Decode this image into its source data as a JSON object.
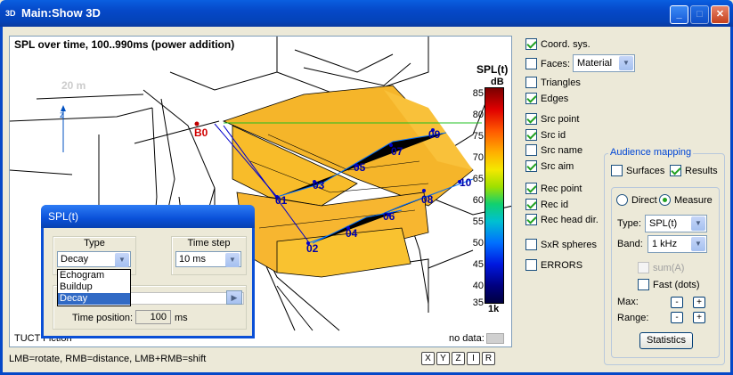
{
  "window": {
    "title": "Main:Show 3D",
    "icon": "3D"
  },
  "view": {
    "title": "SPL over time, 100..990ms (power addition)",
    "distance_label": "20 m",
    "axis_z": "z",
    "source_label": "B0",
    "receivers": [
      "01",
      "02",
      "03",
      "04",
      "05",
      "06",
      "07",
      "08",
      "09",
      "10"
    ],
    "status_left": "TUCT Fiction",
    "no_data_label": "no data:",
    "colorbar": {
      "title": "SPL(t)",
      "unit": "dB",
      "ticks": [
        "85",
        "80",
        "75",
        "70",
        "65",
        "60",
        "55",
        "50",
        "45",
        "40",
        "35"
      ],
      "footer": "1k"
    }
  },
  "statusbar": {
    "hint": "LMB=rotate, RMB=distance, LMB+RMB=shift",
    "axis_buttons": [
      "X",
      "Y",
      "Z",
      "I",
      "R"
    ]
  },
  "options": {
    "coord_sys": {
      "label": "Coord. sys.",
      "checked": true
    },
    "faces": {
      "label": "Faces:",
      "checked": false,
      "value": "Material"
    },
    "triangles": {
      "label": "Triangles",
      "checked": false
    },
    "edges": {
      "label": "Edges",
      "checked": true
    },
    "src_point": {
      "label": "Src point",
      "checked": true
    },
    "src_id": {
      "label": "Src id",
      "checked": true
    },
    "src_name": {
      "label": "Src name",
      "checked": false
    },
    "src_aim": {
      "label": "Src aim",
      "checked": true
    },
    "rec_point": {
      "label": "Rec point",
      "checked": true
    },
    "rec_id": {
      "label": "Rec id",
      "checked": true
    },
    "rec_head": {
      "label": "Rec head dir.",
      "checked": true
    },
    "sxr": {
      "label": "SxR spheres",
      "checked": false
    },
    "errors": {
      "label": "ERRORS",
      "checked": false
    }
  },
  "audience": {
    "group_label": "Audience mapping",
    "surfaces": {
      "label": "Surfaces",
      "checked": false
    },
    "results": {
      "label": "Results",
      "checked": true
    },
    "direct": {
      "label": "Direct",
      "selected": false
    },
    "measure": {
      "label": "Measure",
      "selected": true
    },
    "type_label": "Type:",
    "type_value": "SPL(t)",
    "band_label": "Band:",
    "band_value": "1 kHz",
    "sum_label": "sum(A)",
    "fast_label": "Fast (dots)",
    "max_label": "Max:",
    "range_label": "Range:",
    "minus": "-",
    "plus": "+",
    "statistics_button": "Statistics"
  },
  "dialog": {
    "title": "SPL(t)",
    "type_label": "Type",
    "type_value": "Decay",
    "type_options": [
      "Echogram",
      "Buildup",
      "Decay"
    ],
    "timestep_label": "Time step",
    "timestep_value": "10 ms",
    "time_position_label": "Time position:",
    "time_position_value": "100",
    "time_position_unit": "ms"
  }
}
